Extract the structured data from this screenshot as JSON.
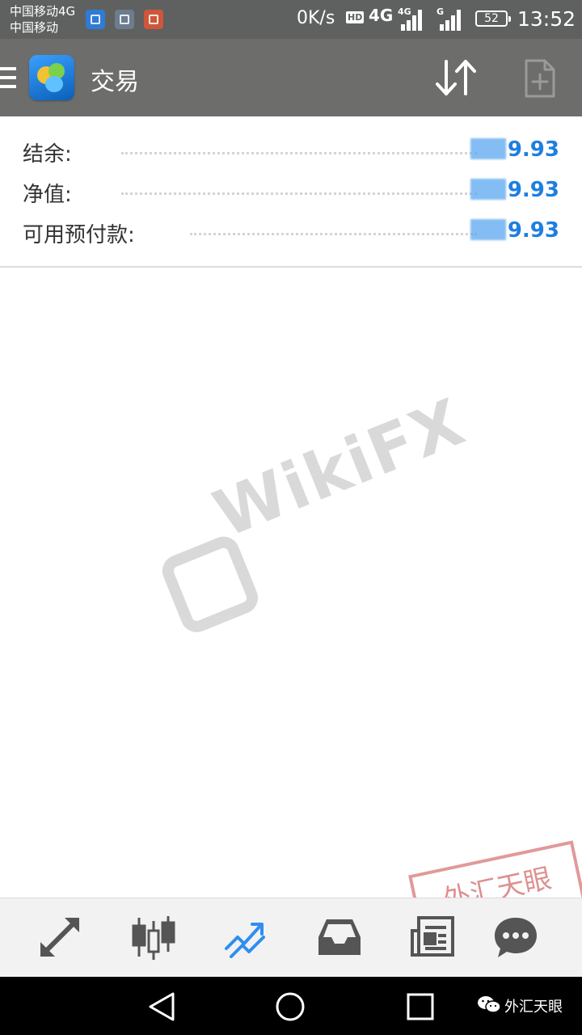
{
  "status_bar": {
    "carrier_1": "中国移动4G",
    "carrier_2": "中国移动",
    "net_speed": "0K/s",
    "hd_badge": "HD",
    "network_type": "4G",
    "signal_1_label": "4G",
    "signal_2_label": "G",
    "battery_level": "52",
    "time": "13:52"
  },
  "app_bar": {
    "title": "交易"
  },
  "account": {
    "rows": [
      {
        "label": "结余:",
        "value": "9.93"
      },
      {
        "label": "净值:",
        "value": "9.93"
      },
      {
        "label": "可用预付款:",
        "value": "9.93"
      }
    ]
  },
  "watermark": {
    "brand": "WikiFX",
    "stamp": "外汇天眼"
  },
  "tab_bar": {
    "active_index": 2,
    "active_color": "#2f8ef0",
    "inactive_color": "#555555",
    "tabs": [
      "trade-arrows",
      "candlesticks",
      "trend-chart",
      "inbox",
      "news",
      "chat"
    ]
  },
  "nav_bar": {
    "wechat_label": "外汇天眼"
  }
}
